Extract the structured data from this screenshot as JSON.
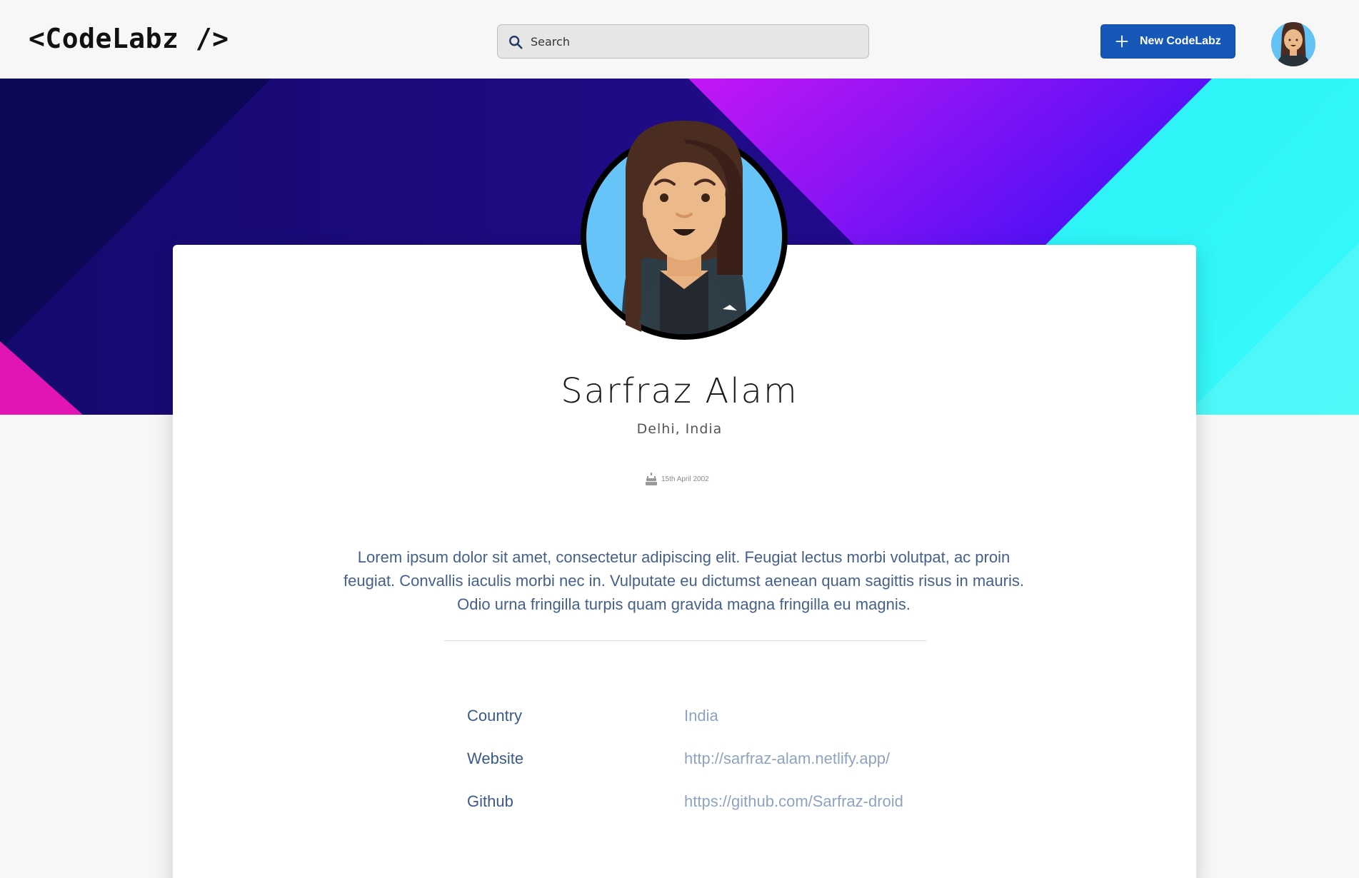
{
  "header": {
    "logo": "<CodeLabz />",
    "search_placeholder": "Search",
    "new_button_label": "New CodeLabz"
  },
  "profile": {
    "name": "Sarfraz Alam",
    "location": "Delhi, India",
    "dob": "15th April 2002",
    "bio": "Lorem ipsum dolor sit amet, consectetur adipiscing elit. Feugiat lectus morbi volutpat, ac proin feugiat. Convallis iaculis morbi nec in. Vulputate eu dictumst aenean quam sagittis risus in mauris. Odio urna fringilla turpis quam gravida magna fringilla eu magnis.",
    "details": [
      {
        "label": "Country",
        "value": "India"
      },
      {
        "label": "Website",
        "value": "http://sarfraz-alam.netlify.app/"
      },
      {
        "label": "Github",
        "value": "https://github.com/Sarfraz-droid"
      }
    ]
  },
  "colors": {
    "primary_button": "#1658b8",
    "label_text": "#3a5a88",
    "value_text": "#8fa3bf"
  },
  "icons": [
    "search-icon",
    "plus-icon",
    "cake-icon"
  ]
}
